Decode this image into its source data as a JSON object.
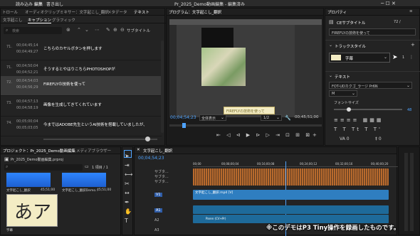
{
  "titlebar": {
    "menu_left": "読み込み",
    "menu_edit": "編集",
    "menu_export": "書き出し",
    "title": "Pr_2025_Demo動画編集 - 編集済み"
  },
  "captions_panel": {
    "tabs": [
      "トロール",
      "オーディオクリップミキサー：文字起こし_翻訳",
      "メタデータ",
      "テキスト"
    ],
    "subtabs": [
      "文字起こし",
      "キャプション",
      "グラフィック"
    ],
    "search_placeholder": "検索",
    "subtitle_label": "サブタイトル",
    "rows": [
      {
        "num": "71.",
        "in": "00;04;45;14",
        "out": "00;04;49;27",
        "text": "こちらのカヤルボタンを押します"
      },
      {
        "num": "71.",
        "in": "00;04;50;04",
        "out": "00;04;52;21",
        "text": "そうするとやはりこちらPHOTOSHOPが"
      },
      {
        "num": "72.",
        "in": "00;04;54;03",
        "out": "00;04;56;29",
        "text": "FIREFLYの技術を使って"
      },
      {
        "num": "73.",
        "in": "00;04;57;13",
        "out": "00;04;58;19",
        "text": "画像を生成してきてくれています"
      },
      {
        "num": "74.",
        "in": "00;05;00;04",
        "out": "00;05;03;05",
        "text": "今まではADOBE先生というAI技術を搭載していましたが、"
      }
    ]
  },
  "program_monitor": {
    "title": "プログラム：文字起こし_翻訳",
    "timecode": "00;04;54;23",
    "fit": "全体表示",
    "ratio": "1/2",
    "duration": "00;45;51;00",
    "caption_text": "FIREFLYの技術を使って"
  },
  "properties_panel": {
    "title": "プロパティ",
    "clip_name": "CEサブタイトル",
    "clip_count": "72 /",
    "text_value": "FIREFLYの技術を使って",
    "track_style_label": "トラックスタイル",
    "track_style_value": "字幕",
    "text_section": "テキスト",
    "font_name": "FOT-UDカクゴ_ラージ Pr6N",
    "font_weight": "M",
    "font_size_label": "フォントサイズ",
    "font_size_value": "48"
  },
  "project_panel": {
    "tabs": [
      "プロジェクト：Pr_2025_Demo動画編集",
      "メディアブラウザー"
    ],
    "filename": "Pr_2025_Demo動画編集.prproj",
    "page_info": "1 項目 / 1",
    "thumb1_label": "文字起こし_翻訳",
    "thumb1_duration": "45;51;00",
    "thumb2_label": "文字起こし_翻訳Demo...",
    "thumb2_duration": "45;51;00",
    "big_thumb_text": "あア",
    "big_thumb_label": "字幕"
  },
  "timeline": {
    "tab_title": "文字起こし_翻訳",
    "timecode": "00;04;54;23",
    "ruler": [
      "00;00",
      "00;08;00;04",
      "00;16;00;08",
      "00;24;00;12",
      "00;32;00;16",
      "00;40;00;20"
    ],
    "caption_tracks": [
      "サブタ...",
      "サブタ...",
      "サブタ..."
    ],
    "video_track": "V1",
    "video_clip": "文字起こし_翻訳.mp4 [V]",
    "audio_tracks": [
      "A1",
      "A2",
      "A3"
    ],
    "audio_label": "Paren (CV+Pr)"
  },
  "overlay_text": "※このデモはP3 Tiny操作を録画したものです。"
}
